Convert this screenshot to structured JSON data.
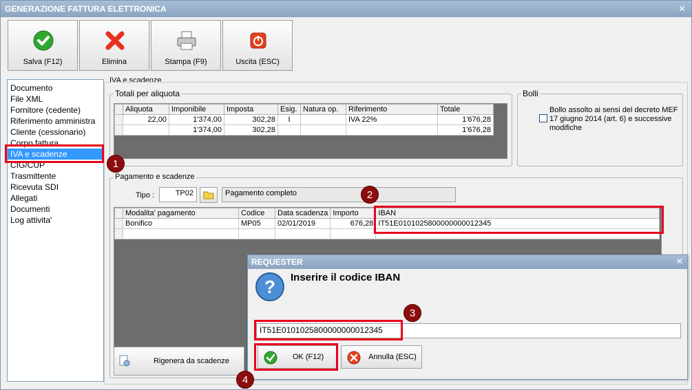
{
  "window": {
    "title": "GENERAZIONE FATTURA ELETTRONICA",
    "close_glyph": "✕"
  },
  "toolbar": {
    "save_label": "Salva (F12)",
    "delete_label": "Elimina",
    "print_label": "Stampa (F9)",
    "exit_label": "Uscita (ESC)"
  },
  "nav": {
    "items": [
      "Documento",
      "File XML",
      "Fornitore (cedente)",
      "Riferimento amministra",
      "Cliente (cessionario)",
      "Corpo fattura",
      "IVA e scadenze",
      "CIG/CUP",
      "Trasmittente",
      "Ricevuta SDI",
      "Allegati",
      "Documenti",
      "Log attivita'"
    ],
    "selected_index": 6
  },
  "iva": {
    "section_title": "IVA e scadenze",
    "totals_group_label": "Totali per aliquota",
    "columns": [
      "Aliquota",
      "Imponibile",
      "Imposta",
      "Esig.",
      "Natura op.",
      "Riferimento",
      "Totale"
    ],
    "rows": [
      [
        "22,00",
        "1'374,00",
        "302,28",
        "I",
        "",
        "IVA 22%",
        "1'676,28"
      ],
      [
        "",
        "1'374,00",
        "302,28",
        "",
        "",
        "",
        "1'676,28"
      ]
    ]
  },
  "bolli": {
    "group_label": "Bolli",
    "checkbox_text": "Bollo assolto ai sensi del decreto MEF 17 giugno 2014 (art. 6) e successive modifiche"
  },
  "pagamento": {
    "group_label": "Pagamento e scadenze",
    "tipo_label": "Tipo :",
    "tipo_value": "TP02",
    "tipo_description": "Pagamento completo",
    "columns": [
      "Modalita' pagamento",
      "Codice",
      "Data scadenza",
      "Importo",
      "IBAN"
    ],
    "rows": [
      [
        "Bonifico",
        "MP05",
        "02/01/2019",
        "676,28",
        "IT51E0101025800000000012345"
      ]
    ],
    "regen_button_label": "Rigenera da scadenze"
  },
  "dialog": {
    "title": "REQUESTER",
    "close_glyph": "✕",
    "message": "Inserire il codice IBAN",
    "input_value": "IT51E0101025800000000012345",
    "ok_label": "OK (F12)",
    "cancel_label": "Annulla (ESC)"
  },
  "annotations": {
    "badge_1": "1",
    "badge_2": "2",
    "badge_3": "3",
    "badge_4": "4"
  },
  "colors": {
    "accent": "#e8001c",
    "selection": "#3399ff",
    "badge": "#8b0d0d"
  }
}
